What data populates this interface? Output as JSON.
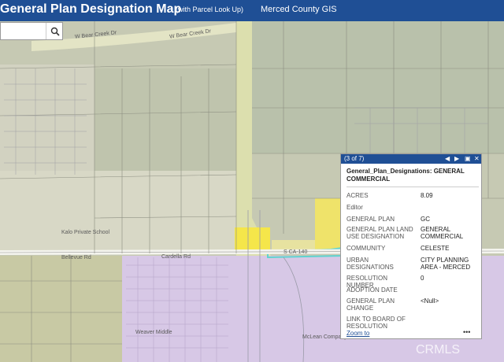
{
  "header": {
    "title": "General Plan Designation Map",
    "subtitle": "(with Parcel Look Up)",
    "org": "Merced County GIS"
  },
  "search": {
    "placeholder": "",
    "button_icon": "search-icon"
  },
  "map": {
    "road_labels": [
      "W Bear Creek Dr",
      "W Bear Creek Dr",
      "Bellevue Rd",
      "Cardella Rd",
      "S CA-140"
    ],
    "place_labels": [
      "Kalo Private School",
      "Weaver Middle",
      "McLean Company"
    ],
    "colors": {
      "agriculture": "#c6c9b3",
      "urban": "#d6d6c4",
      "residential": "#d7c8e6",
      "commercial": "#f5e64a",
      "highlight": "#5fd3cf"
    }
  },
  "popup": {
    "counter": "(3 of 7)",
    "title": "General_Plan_Designations: GENERAL COMMERCIAL",
    "fields": [
      {
        "key": "ACRES",
        "value": "8.09"
      },
      {
        "key": "Editor",
        "value": ""
      },
      {
        "key": "GENERAL PLAN",
        "value": "GC"
      },
      {
        "key": "GENERAL PLAN LAND USE DESIGNATION",
        "value": "GENERAL COMMERCIAL"
      },
      {
        "key": "COMMUNITY",
        "value": "CELESTE"
      },
      {
        "key": "URBAN DESIGNATIONS",
        "value": "CITY PLANNING AREA - MERCED"
      },
      {
        "key": "RESOLUTION NUMBER",
        "value": "0"
      },
      {
        "key": "ADOPTION DATE",
        "value": ""
      },
      {
        "key": "GENERAL PLAN CHANGE",
        "value": "<Null>"
      },
      {
        "key": "LINK TO BOARD OF RESOLUTION",
        "value": ""
      }
    ],
    "zoom_label": "Zoom to",
    "more_label": "•••"
  },
  "watermark": "CRMLS"
}
